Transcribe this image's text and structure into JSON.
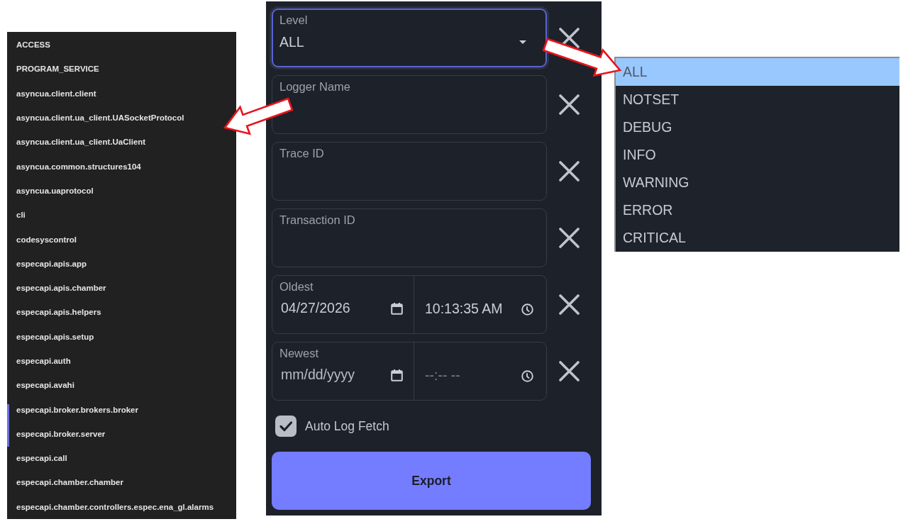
{
  "logger_list": {
    "items": [
      "ACCESS",
      "PROGRAM_SERVICE",
      "asyncua.client.client",
      "asyncua.client.ua_client.UASocketProtocol",
      "asyncua.client.ua_client.UaClient",
      "asyncua.common.structures104",
      "asyncua.uaprotocol",
      "cli",
      "codesyscontrol",
      "especapi.apis.app",
      "especapi.apis.chamber",
      "especapi.apis.helpers",
      "especapi.apis.setup",
      "especapi.auth",
      "especapi.avahi",
      "especapi.broker.brokers.broker",
      "especapi.broker.server",
      "especapi.call",
      "especapi.chamber.chamber",
      "especapi.chamber.controllers.espec.ena_gl.alarms"
    ]
  },
  "filter_panel": {
    "fields": [
      {
        "kind": "select",
        "label": "Level",
        "value": "ALL",
        "focused": true
      },
      {
        "kind": "text",
        "label": "Logger Name"
      },
      {
        "kind": "text",
        "label": "Trace ID"
      },
      {
        "kind": "text",
        "label": "Transaction ID"
      },
      {
        "kind": "datetime",
        "label": "Oldest",
        "date": {
          "value": "04/27/2026"
        },
        "time": {
          "value": "10:13:35 AM"
        }
      },
      {
        "kind": "datetime",
        "label": "Newest",
        "date": {
          "placeholder": "mm/dd/yyyy"
        },
        "time": {
          "placeholder": "--:-- --"
        }
      }
    ],
    "auto_fetch": {
      "label": "Auto Log Fetch",
      "checked": true
    },
    "export_button": {
      "label": "Export"
    }
  },
  "level_menu": {
    "options": [
      {
        "label": "ALL",
        "selected": true
      },
      {
        "label": "NOTSET",
        "selected": false
      },
      {
        "label": "DEBUG",
        "selected": false
      },
      {
        "label": "INFO",
        "selected": false
      },
      {
        "label": "WARNING",
        "selected": false
      },
      {
        "label": "ERROR",
        "selected": false
      },
      {
        "label": "CRITICAL",
        "selected": false
      }
    ]
  }
}
